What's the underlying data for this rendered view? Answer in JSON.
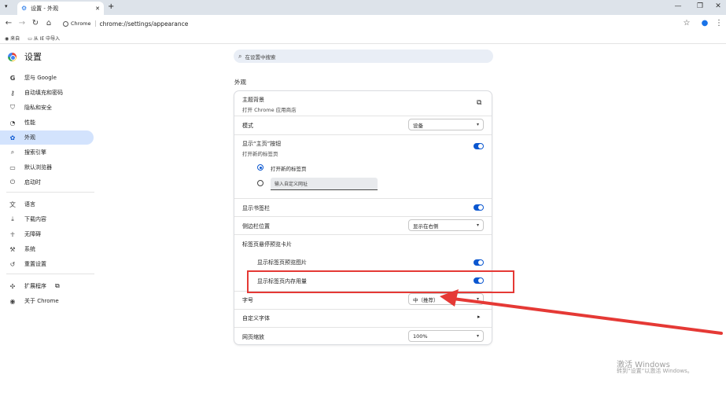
{
  "browser": {
    "tab_title": "设置 - 外观",
    "new_tab": "+",
    "window_controls": [
      "—",
      "❐",
      "✕"
    ],
    "chip_label": "Chrome",
    "url": "chrome://settings/appearance",
    "bookmarks": [
      "来自",
      "从 IE 中导入"
    ]
  },
  "sidebar": {
    "title": "设置",
    "items": [
      {
        "label": "您与 Google",
        "icon": "google-g-icon"
      },
      {
        "label": "自动填充和密码",
        "icon": "key-icon"
      },
      {
        "label": "隐私和安全",
        "icon": "shield-icon"
      },
      {
        "label": "性能",
        "icon": "speedometer-icon"
      },
      {
        "label": "外观",
        "icon": "palette-icon"
      },
      {
        "label": "搜索引擎",
        "icon": "search-icon"
      },
      {
        "label": "默认浏览器",
        "icon": "browser-window-icon"
      },
      {
        "label": "启动时",
        "icon": "power-icon"
      },
      {
        "label": "语言",
        "icon": "translate-icon"
      },
      {
        "label": "下载内容",
        "icon": "download-icon"
      },
      {
        "label": "无障碍",
        "icon": "accessibility-icon"
      },
      {
        "label": "系统",
        "icon": "wrench-icon"
      },
      {
        "label": "重置设置",
        "icon": "reset-icon"
      },
      {
        "label": "扩展程序",
        "icon": "puzzle-icon"
      },
      {
        "label": "关于 Chrome",
        "icon": "chrome-icon"
      }
    ]
  },
  "search": {
    "placeholder": "在设置中搜索"
  },
  "section_title": "外观",
  "settings": {
    "theme_label": "主题背景",
    "theme_sub": "打开 Chrome 应用商店",
    "mode_label": "模式",
    "mode_value": "设备",
    "home_label": "显示“主页”按钮",
    "home_sub": "打开新的标签页",
    "radio_newtab": "打开新的标签页",
    "radio_custom_placeholder": "输入自定义网址",
    "bookmarks_bar_label": "显示书签栏",
    "side_panel_label": "侧边栏位置",
    "side_panel_value": "显示在右侧",
    "hover_cards_label": "标签页悬停预览卡片",
    "hover_image_label": "显示标签页预览图片",
    "memory_label": "显示标签页内存用量",
    "font_size_label": "字号",
    "font_size_value": "中（推荐）",
    "custom_fonts_label": "自定义字体",
    "zoom_label": "网页缩放",
    "zoom_value": "100%"
  },
  "watermark": {
    "line1": "激活 Windows",
    "line2": "转到“设置”以激活 Windows。"
  },
  "colors": {
    "accent": "#0b57d0",
    "highlight": "#e53935"
  }
}
